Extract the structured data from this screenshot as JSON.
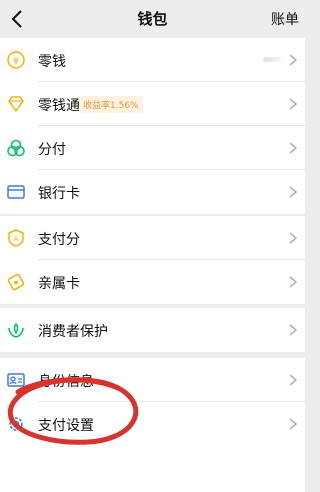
{
  "header": {
    "title": "钱包",
    "right_label": "账单"
  },
  "groups": [
    {
      "items": [
        {
          "label": "零钱",
          "icon": "coin-icon"
        },
        {
          "label": "零钱通",
          "icon": "diamond-icon",
          "badge": "收益率1.56%"
        },
        {
          "label": "分付",
          "icon": "fenfu-icon"
        },
        {
          "label": "银行卡",
          "icon": "bank-card-icon"
        }
      ]
    },
    {
      "items": [
        {
          "label": "支付分",
          "icon": "pay-score-icon"
        },
        {
          "label": "亲属卡",
          "icon": "family-card-icon"
        }
      ]
    },
    {
      "items": [
        {
          "label": "消费者保护",
          "icon": "consumer-protection-icon"
        }
      ]
    },
    {
      "items": [
        {
          "label": "身份信息",
          "icon": "id-card-icon"
        },
        {
          "label": "支付设置",
          "icon": "settings-icon"
        }
      ]
    }
  ],
  "colors": {
    "accent_yellow": "#f2b300",
    "accent_green": "#07c160",
    "accent_blue": "#3b7ddd",
    "annotation_red": "#d8332c"
  }
}
